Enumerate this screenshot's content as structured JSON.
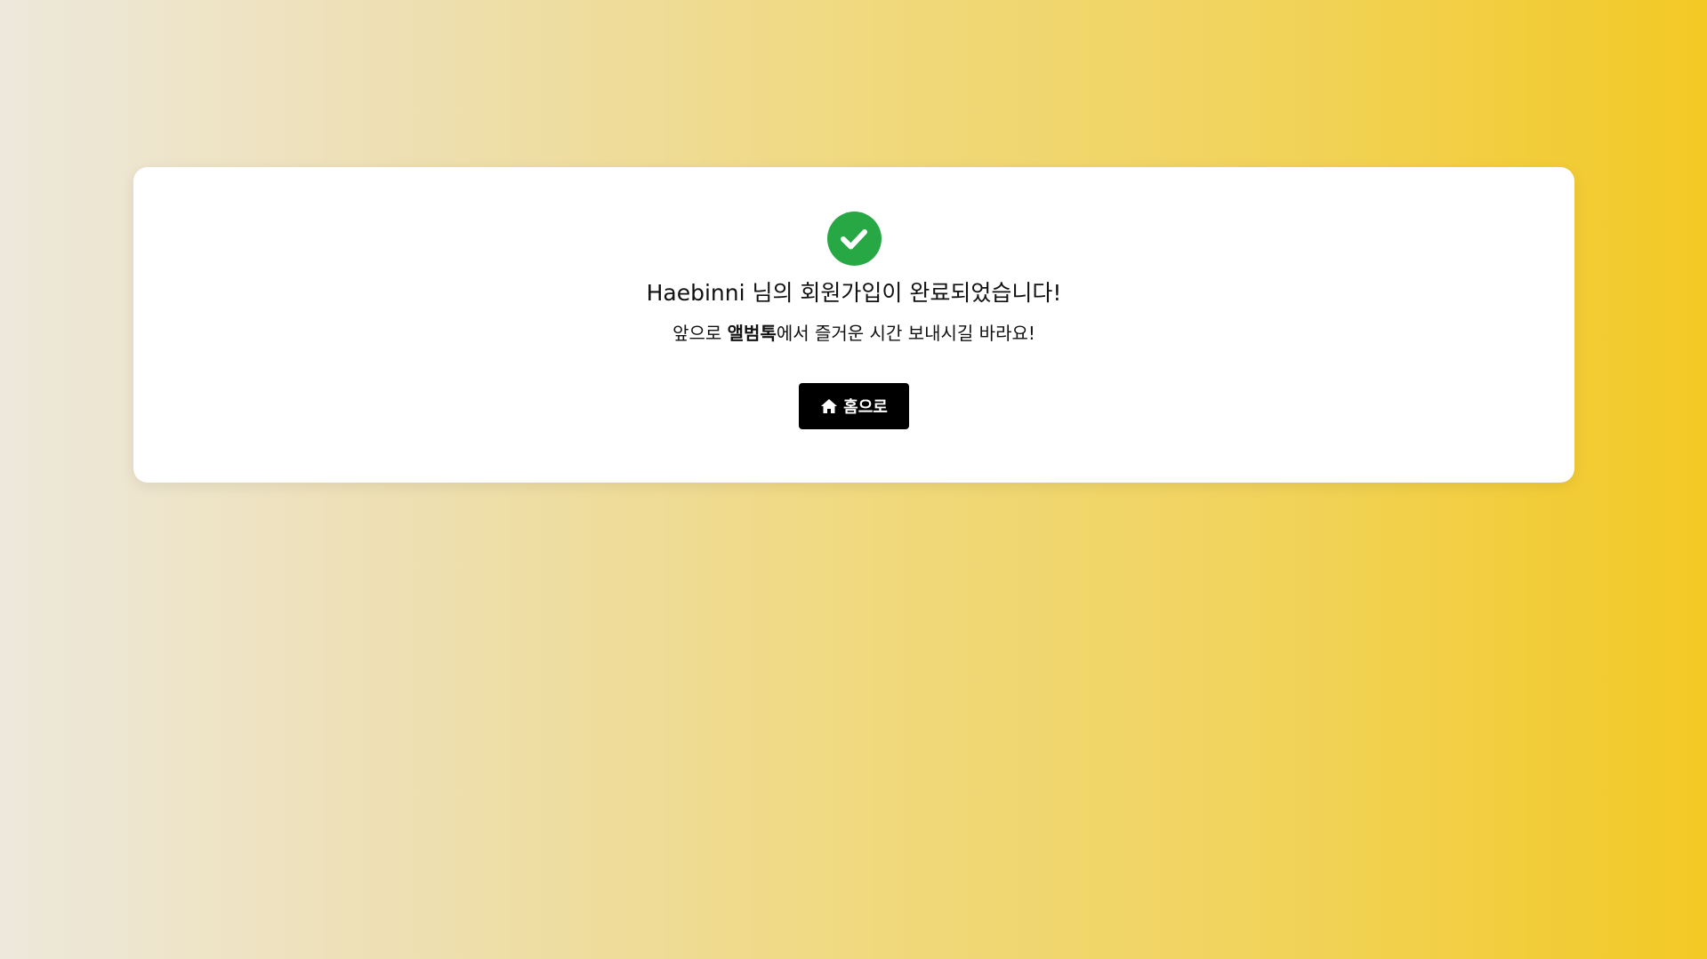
{
  "confirmation": {
    "icon": "check-circle-icon",
    "icon_color": "#28a745",
    "title": "Haebinni 님의 회원가입이 완료되었습니다!",
    "subtitle_prefix": "앞으로 ",
    "subtitle_brand": "앨범톡",
    "subtitle_suffix": "에서 즐거운 시간 보내시길 바라요!"
  },
  "home_button": {
    "icon": "home-icon",
    "label": "홈으로",
    "background": "#000000"
  },
  "background": {
    "gradient_start": "#ede8dc",
    "gradient_end": "#f3c925"
  }
}
